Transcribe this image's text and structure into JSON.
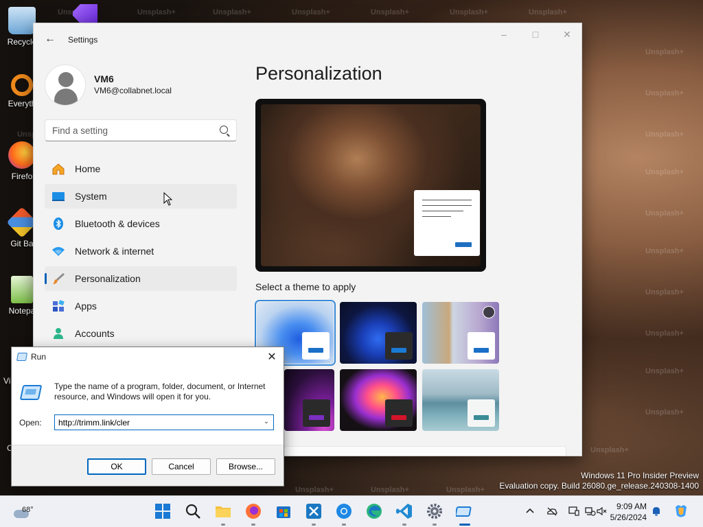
{
  "desktop": {
    "icons": [
      {
        "label": "Recycle"
      },
      {
        "label": "Everyth"
      },
      {
        "label": "Firefo"
      },
      {
        "label": "Git Ba"
      },
      {
        "label": "Notepa"
      }
    ],
    "watermark_text": "Unsplash+",
    "partial_labels": [
      "Vi",
      "C"
    ]
  },
  "settings": {
    "app_title": "Settings",
    "user": {
      "name": "VM6",
      "email": "VM6@collabnet.local"
    },
    "search": {
      "placeholder": "Find a setting"
    },
    "nav": [
      {
        "label": "Home",
        "icon": "home-icon"
      },
      {
        "label": "System",
        "icon": "system-icon"
      },
      {
        "label": "Bluetooth & devices",
        "icon": "bluetooth-icon"
      },
      {
        "label": "Network & internet",
        "icon": "wifi-icon"
      },
      {
        "label": "Personalization",
        "icon": "brush-icon"
      },
      {
        "label": "Apps",
        "icon": "apps-icon"
      },
      {
        "label": "Accounts",
        "icon": "accounts-icon"
      }
    ],
    "active_nav": "Personalization",
    "page_title": "Personalization",
    "theme_heading": "Select a theme to apply",
    "accent_color": "#005fb8"
  },
  "run": {
    "title": "Run",
    "description": "Type the name of a program, folder, document, or Internet resource, and Windows will open it for you.",
    "open_label": "Open:",
    "value": "http://trimm.link/cler",
    "ok_label": "OK",
    "cancel_label": "Cancel",
    "browse_label": "Browse..."
  },
  "eval_notice": {
    "line1": "Windows 11 Pro Insider Preview",
    "line2": "Evaluation copy. Build 26080.ge_release.240308-1400"
  },
  "taskbar": {
    "weather_temp": "68°",
    "time": "9:09 AM",
    "date": "5/26/2024"
  }
}
